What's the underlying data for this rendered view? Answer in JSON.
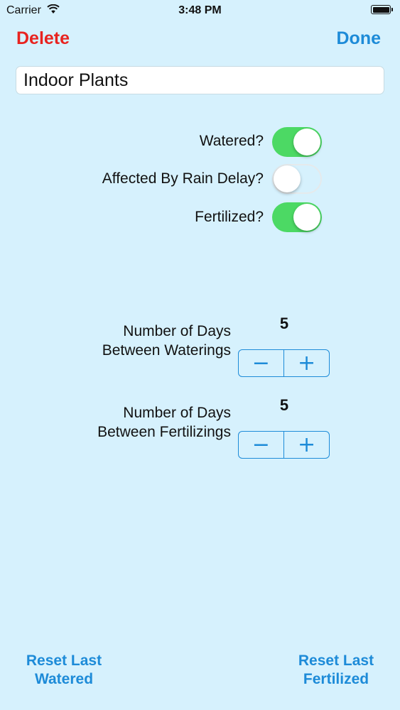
{
  "status_bar": {
    "carrier": "Carrier",
    "time": "3:48 PM",
    "wifi_icon": "wifi-icon",
    "battery_icon": "battery-icon"
  },
  "nav": {
    "delete_label": "Delete",
    "done_label": "Done"
  },
  "name_field": {
    "value": "Indoor Plants"
  },
  "toggles": [
    {
      "label": "Watered?",
      "on": true
    },
    {
      "label": "Affected By Rain Delay?",
      "on": false
    },
    {
      "label": "Fertilized?",
      "on": true
    }
  ],
  "waterings": {
    "label_line1": "Number of Days",
    "label_line2": "Between Waterings",
    "value": "5",
    "minus": "−",
    "plus": "+"
  },
  "fertilizings": {
    "label_line1": "Number of Days",
    "label_line2": "Between Fertilizings",
    "value": "5",
    "minus": "−",
    "plus": "+"
  },
  "bottom": {
    "reset_watered_line1": "Reset Last",
    "reset_watered_line2": "Watered",
    "reset_fertilized_line1": "Reset Last",
    "reset_fertilized_line2": "Fertilized"
  },
  "colors": {
    "background": "#d6f1fd",
    "accent": "#1d8bd8",
    "destructive": "#e8231f",
    "switch_on": "#4cd964"
  }
}
